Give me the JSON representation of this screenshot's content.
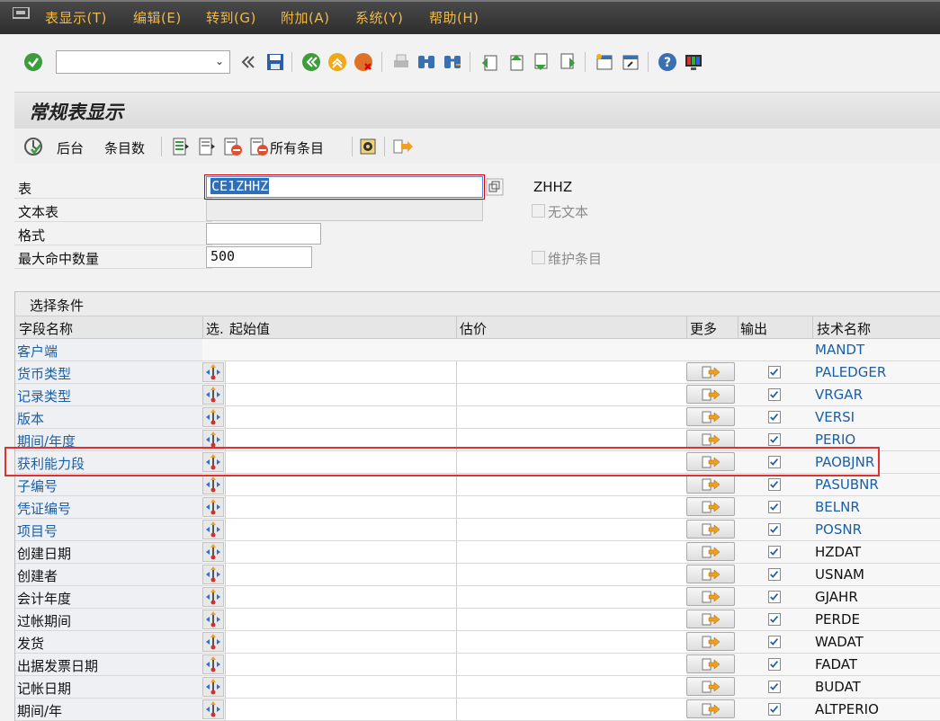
{
  "menu": [
    "表显示(T)",
    "编辑(E)",
    "转到(G)",
    "附加(A)",
    "系统(Y)",
    "帮助(H)"
  ],
  "toolbar": {
    "command_value": "",
    "icons": [
      "enter-icon",
      "command-field",
      "back-nav-icon",
      "save-icon",
      "back-icon",
      "exit-icon",
      "cancel-icon",
      "print-icon",
      "find-icon",
      "find-next-icon",
      "first-page-icon",
      "previous-page-icon",
      "next-page-icon",
      "last-page-icon",
      "new-session-icon",
      "shortcut-icon",
      "help-icon",
      "customize-layout-icon"
    ]
  },
  "title": "常规表显示",
  "app_toolbar": {
    "execute": "",
    "background": "后台",
    "entry_count": "条目数",
    "all_entries": "所有条目"
  },
  "form": {
    "table_label": "表",
    "table_value": "CE1ZHHZ",
    "table_desc": "ZHHZ",
    "text_table_label": "文本表",
    "no_text_label": "无文本",
    "layout_label": "格式",
    "max_hits_label": "最大命中数量",
    "max_hits_value": "500",
    "maintain_entries_label": "维护条目"
  },
  "selection": {
    "header": "选择条件",
    "columns": {
      "field": "字段名称",
      "sel": "选.",
      "from": "起始值",
      "to": "估价",
      "more": "更多",
      "output": "输出",
      "tech": "技术名称"
    },
    "rows": [
      {
        "field": "客户端",
        "tech": "MANDT",
        "link": true,
        "key": true
      },
      {
        "field": "货币类型",
        "tech": "PALEDGER",
        "link": true
      },
      {
        "field": "记录类型",
        "tech": "VRGAR",
        "link": true
      },
      {
        "field": "版本",
        "tech": "VERSI",
        "link": true
      },
      {
        "field": "期间/年度",
        "tech": "PERIO",
        "link": true
      },
      {
        "field": "获利能力段",
        "tech": "PAOBJNR",
        "link": true
      },
      {
        "field": "子编号",
        "tech": "PASUBNR",
        "link": true
      },
      {
        "field": "凭证编号",
        "tech": "BELNR",
        "link": true
      },
      {
        "field": "项目号",
        "tech": "POSNR",
        "link": true
      },
      {
        "field": "创建日期",
        "tech": "HZDAT",
        "link": false
      },
      {
        "field": "创建者",
        "tech": "USNAM",
        "link": false
      },
      {
        "field": "会计年度",
        "tech": "GJAHR",
        "link": false
      },
      {
        "field": "过帐期间",
        "tech": "PERDE",
        "link": false
      },
      {
        "field": "发货",
        "tech": "WADAT",
        "link": false
      },
      {
        "field": "出据发票日期",
        "tech": "FADAT",
        "link": false
      },
      {
        "field": "记帐日期",
        "tech": "BUDAT",
        "link": false
      },
      {
        "field": "期间/年",
        "tech": "ALTPERIO",
        "link": false
      }
    ],
    "highlighted_row": "PAOBJNR"
  }
}
